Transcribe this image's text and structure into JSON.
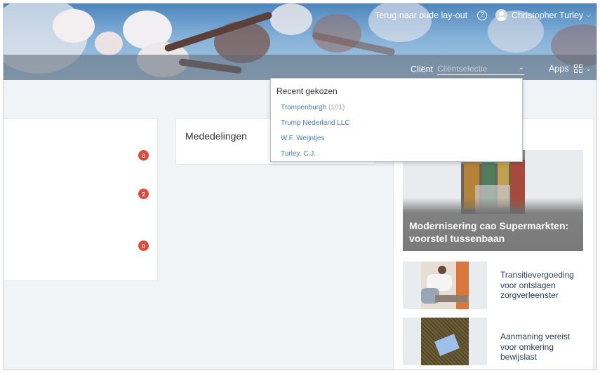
{
  "header": {
    "old_layout_link": "Terug naar oude lay-out",
    "help_icon": "?",
    "user_name": "Christopher Turley",
    "client_label": "Cliënt",
    "client_placeholder": "Cliëntselectie",
    "apps_label": "Apps"
  },
  "left_card": {
    "badges": [
      "0",
      "2",
      "0"
    ]
  },
  "announcements": {
    "title": "Mededelingen"
  },
  "client_dropdown": {
    "heading": "Recent gekozen",
    "items": [
      {
        "name": "Trompenburgh",
        "count": "(101)"
      },
      {
        "name": "Trump Nederland LLC",
        "count": ""
      },
      {
        "name": "W.F. Weijntjes",
        "count": ""
      },
      {
        "name": "Turley, C.J.",
        "count": ""
      }
    ]
  },
  "news": {
    "featured_title": "Modernisering cao Supermarkten: voorstel tussenbaan",
    "items": [
      {
        "title": "Transitievergoeding voor ontslagen zorgverleenster"
      },
      {
        "title": "Aanmaning vereist voor omkering bewijslast"
      }
    ]
  },
  "colors": {
    "badge": "#e04a3a",
    "link": "#4a7bab",
    "header_bar": "#5c6874"
  }
}
